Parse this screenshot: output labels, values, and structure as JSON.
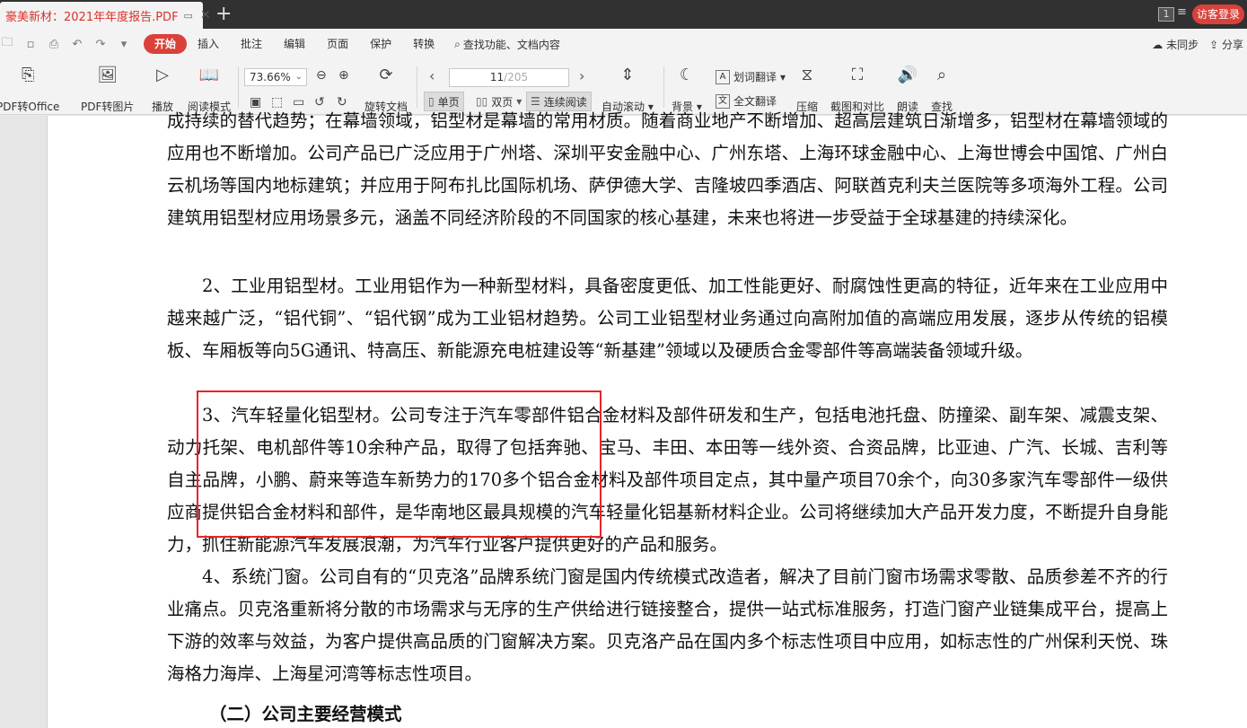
{
  "tabbar": {
    "tab_title": "豪美新材：2021年年度报告.PDF",
    "new_tab": "+",
    "tab_count": "1",
    "menu_glyph": "≡",
    "login_label": "访客登录"
  },
  "menu": {
    "quick_icons": [
      "open-folder-icon",
      "save-icon",
      "print-icon",
      "undo-icon",
      "redo-icon",
      "more-icon"
    ],
    "items": [
      "开始",
      "插入",
      "批注",
      "编辑",
      "页面",
      "保护",
      "转换"
    ],
    "search_label": "查找功能、文档内容",
    "sync_label": "未同步",
    "share_label": "分享"
  },
  "toolbar": {
    "pdf_to_office": "PDF转Office",
    "pdf_to_image": "PDF转图片",
    "play": "播放",
    "read_mode": "阅读模式",
    "zoom_value": "73.66%",
    "rotate_doc": "旋转文档",
    "page_current": "11",
    "page_total": "/205",
    "single_page": "单页",
    "double_page": "双页",
    "continuous_read": "连续阅读",
    "auto_scroll": "自动滚动",
    "background": "背景",
    "word_translate": "划词翻译",
    "full_translate": "全文翻译",
    "compress": "压缩",
    "screenshot_compare": "截图和对比",
    "read_aloud": "朗读",
    "find": "查找"
  },
  "document": {
    "paragraphs": [
      "成持续的替代趋势；在幕墙领域，铝型材是幕墙的常用材质。随着商业地产不断增加、超高层建筑日渐增多，铝型材在幕墙领域的应用也不断增加。公司产品已广泛应用于广州塔、深圳平安金融中心、广州东塔、上海环球金融中心、上海世博会中国馆、广州白云机场等国内地标建筑；并应用于阿布扎比国际机场、萨伊德大学、吉隆坡四季酒店、阿联酋克利夫兰医院等多项海外工程。公司建筑用铝型材应用场景多元，涵盖不同经济阶段的不同国家的核心基建，未来也将进一步受益于全球基建的持续深化。",
      "2、工业用铝型材。工业用铝作为一种新型材料，具备密度更低、加工性能更好、耐腐蚀性更高的特征，近年来在工业应用中越来越广泛，“铝代铜”、“铝代钢”成为工业铝材趋势。公司工业铝型材业务通过向高附加值的高端应用发展，逐步从传统的铝模板、车厢板等向5G通讯、特高压、新能源充电桩建设等“新基建”领域以及硬质合金零部件等高端装备领域升级。",
      "3、汽车轻量化铝型材。公司专注于汽车零部件铝合金材料及部件研发和生产，包括电池托盘、防撞梁、副车架、减震支架、动力托架、电机部件等10余种产品，取得了包括奔驰、宝马、丰田、本田等一线外资、合资品牌，比亚迪、广汽、长城、吉利等自主品牌，小鹏、蔚来等造车新势力的170多个铝合金材料及部件项目定点，其中量产项目70余个，向30多家汽车零部件一级供应商提供铝合金材料和部件，是华南地区最具规模的汽车轻量化铝基新材料企业。公司将继续加大产品开发力度，不断提升自身能力，抓住新能源汽车发展浪潮，为汽车行业客户提供更好的产品和服务。",
      "4、系统门窗。公司自有的“贝克洛”品牌系统门窗是国内传统模式改造者，解决了目前门窗市场需求零散、品质参差不齐的行业痛点。贝克洛重新将分散的市场需求与无序的生产供给进行链接整合，提供一站式标准服务，打造门窗产业链集成平台，提高上下游的效率与效益，为客户提供高品质的门窗解决方案。贝克洛产品在国内多个标志性项目中应用，如标志性的广州保利天悦、珠海格力海岸、上海星河湾等标志性项目。"
    ],
    "section_heading": "（二）公司主要经营模式"
  },
  "colors": {
    "accent": "#d9413a",
    "highlight_box": "#e8242b",
    "tabbar_bg": "#313131"
  }
}
